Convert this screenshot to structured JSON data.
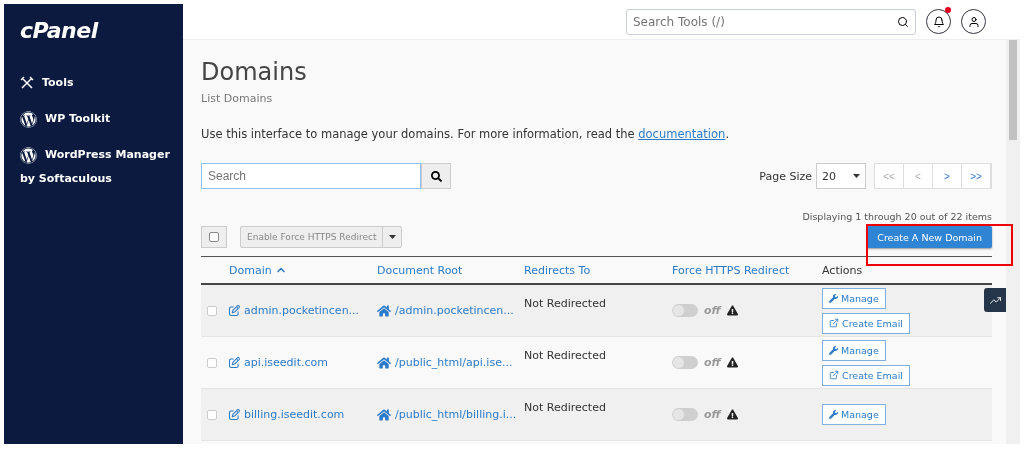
{
  "sidebar": {
    "logo": "cPanel",
    "items": [
      {
        "kind": "tools",
        "label": "Tools"
      },
      {
        "kind": "wordpress",
        "label": "WP Toolkit"
      },
      {
        "kind": "wordpress",
        "label": "WordPress Manager by Softaculous"
      }
    ]
  },
  "topbar": {
    "search": {
      "placeholder": "Search Tools (/)"
    },
    "notifications": {
      "unread": true
    }
  },
  "page": {
    "title": "Domains",
    "subtitle": "List Domains",
    "description": "Use this interface to manage your domains. For more information, read the ",
    "description_link": "documentation",
    "description_end": "."
  },
  "search": {
    "placeholder": "Search"
  },
  "page_size": {
    "label": "Page Size",
    "value": "20"
  },
  "pager": [
    {
      "label": "<<",
      "disabled": true
    },
    {
      "label": "<",
      "disabled": true
    },
    {
      "label": ">",
      "disabled": false
    },
    {
      "label": ">>",
      "disabled": false
    }
  ],
  "displaying": "Displaying 1 through 20 out of 22 items",
  "select_all": {
    "checked": false
  },
  "bulk_action": {
    "label": "Enable Force HTTPS Redirect",
    "disabled": true
  },
  "create_button": {
    "label": "Create A New Domain",
    "highlighted": true
  },
  "table": {
    "columns": [
      {
        "label": "Domain",
        "sortable": true,
        "sorted": true
      },
      {
        "label": "Document Root",
        "sortable": true,
        "sorted": false
      },
      {
        "label": "Redirects To",
        "sortable": true,
        "sorted": false
      },
      {
        "label": "Force HTTPS Redirect",
        "sortable": true,
        "sorted": false
      },
      {
        "label": "Actions",
        "sortable": false,
        "sorted": false
      }
    ],
    "rows": [
      {
        "checked": false,
        "domain": "admin.pocketincen...",
        "root": "/admin.pocketincen...",
        "redirect": "Not Redirected",
        "https": {
          "on": false,
          "label": "off"
        },
        "actions": [
          "Manage",
          "Create Email"
        ]
      },
      {
        "checked": false,
        "domain": "api.iseedit.com",
        "root": "/public_html/api.ise...",
        "redirect": "Not Redirected",
        "https": {
          "on": false,
          "label": "off"
        },
        "actions": [
          "Manage",
          "Create Email"
        ]
      },
      {
        "checked": false,
        "domain": "billing.iseedit.com",
        "root": "/public_html/billing.i...",
        "redirect": "Not Redirected",
        "https": {
          "on": false,
          "label": "off"
        },
        "actions": [
          "Manage"
        ]
      }
    ]
  }
}
